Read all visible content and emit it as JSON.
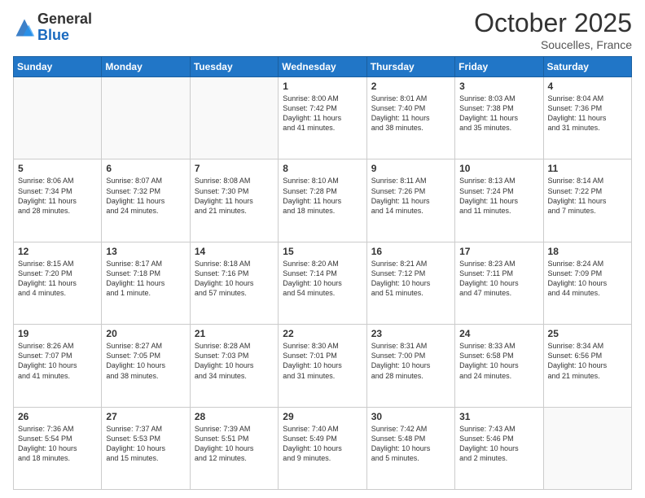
{
  "header": {
    "logo_general": "General",
    "logo_blue": "Blue",
    "month": "October 2025",
    "location": "Soucelles, France"
  },
  "weekdays": [
    "Sunday",
    "Monday",
    "Tuesday",
    "Wednesday",
    "Thursday",
    "Friday",
    "Saturday"
  ],
  "weeks": [
    [
      {
        "day": "",
        "info": ""
      },
      {
        "day": "",
        "info": ""
      },
      {
        "day": "",
        "info": ""
      },
      {
        "day": "1",
        "info": "Sunrise: 8:00 AM\nSunset: 7:42 PM\nDaylight: 11 hours\nand 41 minutes."
      },
      {
        "day": "2",
        "info": "Sunrise: 8:01 AM\nSunset: 7:40 PM\nDaylight: 11 hours\nand 38 minutes."
      },
      {
        "day": "3",
        "info": "Sunrise: 8:03 AM\nSunset: 7:38 PM\nDaylight: 11 hours\nand 35 minutes."
      },
      {
        "day": "4",
        "info": "Sunrise: 8:04 AM\nSunset: 7:36 PM\nDaylight: 11 hours\nand 31 minutes."
      }
    ],
    [
      {
        "day": "5",
        "info": "Sunrise: 8:06 AM\nSunset: 7:34 PM\nDaylight: 11 hours\nand 28 minutes."
      },
      {
        "day": "6",
        "info": "Sunrise: 8:07 AM\nSunset: 7:32 PM\nDaylight: 11 hours\nand 24 minutes."
      },
      {
        "day": "7",
        "info": "Sunrise: 8:08 AM\nSunset: 7:30 PM\nDaylight: 11 hours\nand 21 minutes."
      },
      {
        "day": "8",
        "info": "Sunrise: 8:10 AM\nSunset: 7:28 PM\nDaylight: 11 hours\nand 18 minutes."
      },
      {
        "day": "9",
        "info": "Sunrise: 8:11 AM\nSunset: 7:26 PM\nDaylight: 11 hours\nand 14 minutes."
      },
      {
        "day": "10",
        "info": "Sunrise: 8:13 AM\nSunset: 7:24 PM\nDaylight: 11 hours\nand 11 minutes."
      },
      {
        "day": "11",
        "info": "Sunrise: 8:14 AM\nSunset: 7:22 PM\nDaylight: 11 hours\nand 7 minutes."
      }
    ],
    [
      {
        "day": "12",
        "info": "Sunrise: 8:15 AM\nSunset: 7:20 PM\nDaylight: 11 hours\nand 4 minutes."
      },
      {
        "day": "13",
        "info": "Sunrise: 8:17 AM\nSunset: 7:18 PM\nDaylight: 11 hours\nand 1 minute."
      },
      {
        "day": "14",
        "info": "Sunrise: 8:18 AM\nSunset: 7:16 PM\nDaylight: 10 hours\nand 57 minutes."
      },
      {
        "day": "15",
        "info": "Sunrise: 8:20 AM\nSunset: 7:14 PM\nDaylight: 10 hours\nand 54 minutes."
      },
      {
        "day": "16",
        "info": "Sunrise: 8:21 AM\nSunset: 7:12 PM\nDaylight: 10 hours\nand 51 minutes."
      },
      {
        "day": "17",
        "info": "Sunrise: 8:23 AM\nSunset: 7:11 PM\nDaylight: 10 hours\nand 47 minutes."
      },
      {
        "day": "18",
        "info": "Sunrise: 8:24 AM\nSunset: 7:09 PM\nDaylight: 10 hours\nand 44 minutes."
      }
    ],
    [
      {
        "day": "19",
        "info": "Sunrise: 8:26 AM\nSunset: 7:07 PM\nDaylight: 10 hours\nand 41 minutes."
      },
      {
        "day": "20",
        "info": "Sunrise: 8:27 AM\nSunset: 7:05 PM\nDaylight: 10 hours\nand 38 minutes."
      },
      {
        "day": "21",
        "info": "Sunrise: 8:28 AM\nSunset: 7:03 PM\nDaylight: 10 hours\nand 34 minutes."
      },
      {
        "day": "22",
        "info": "Sunrise: 8:30 AM\nSunset: 7:01 PM\nDaylight: 10 hours\nand 31 minutes."
      },
      {
        "day": "23",
        "info": "Sunrise: 8:31 AM\nSunset: 7:00 PM\nDaylight: 10 hours\nand 28 minutes."
      },
      {
        "day": "24",
        "info": "Sunrise: 8:33 AM\nSunset: 6:58 PM\nDaylight: 10 hours\nand 24 minutes."
      },
      {
        "day": "25",
        "info": "Sunrise: 8:34 AM\nSunset: 6:56 PM\nDaylight: 10 hours\nand 21 minutes."
      }
    ],
    [
      {
        "day": "26",
        "info": "Sunrise: 7:36 AM\nSunset: 5:54 PM\nDaylight: 10 hours\nand 18 minutes."
      },
      {
        "day": "27",
        "info": "Sunrise: 7:37 AM\nSunset: 5:53 PM\nDaylight: 10 hours\nand 15 minutes."
      },
      {
        "day": "28",
        "info": "Sunrise: 7:39 AM\nSunset: 5:51 PM\nDaylight: 10 hours\nand 12 minutes."
      },
      {
        "day": "29",
        "info": "Sunrise: 7:40 AM\nSunset: 5:49 PM\nDaylight: 10 hours\nand 9 minutes."
      },
      {
        "day": "30",
        "info": "Sunrise: 7:42 AM\nSunset: 5:48 PM\nDaylight: 10 hours\nand 5 minutes."
      },
      {
        "day": "31",
        "info": "Sunrise: 7:43 AM\nSunset: 5:46 PM\nDaylight: 10 hours\nand 2 minutes."
      },
      {
        "day": "",
        "info": ""
      }
    ]
  ]
}
